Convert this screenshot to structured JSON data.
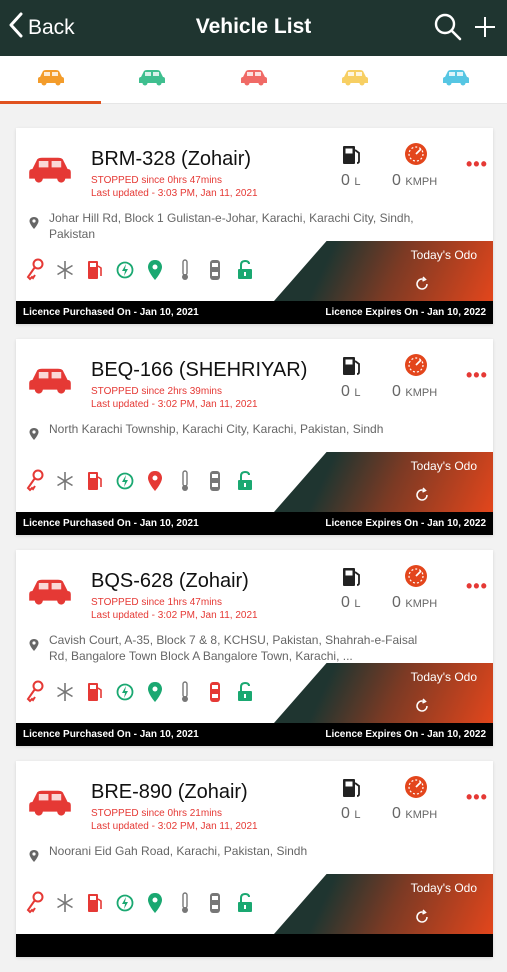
{
  "header": {
    "back_label": "Back",
    "title": "Vehicle List",
    "icons": [
      "search-icon",
      "add-icon"
    ]
  },
  "tabs": [
    {
      "color": "#f39c2b",
      "icon": "car-icon",
      "active": true
    },
    {
      "color": "#3fbf8f",
      "icon": "car-icon",
      "active": false
    },
    {
      "color": "#f06a66",
      "icon": "car-icon",
      "active": false
    },
    {
      "color": "#f7cf63",
      "icon": "car-icon",
      "active": false
    },
    {
      "color": "#56c6e3",
      "icon": "car-icon",
      "active": false
    }
  ],
  "vehicles": [
    {
      "plate": "BRM-328 (Zohair)",
      "stopped": "STOPPED since 0hrs 47mins",
      "updated": "Last updated - 3:03 PM, Jan 11, 2021",
      "fuel_value": "0",
      "fuel_unit": "L",
      "speed_value": "0",
      "speed_unit": "KMPH",
      "address": "Johar Hill Rd, Block 1 Gulistan-e-Johar, Karachi, Karachi City, Sindh, Pakistan",
      "odo_label": "Today's Odo",
      "licence_purchased": "Licence Purchased On - Jan 10, 2021",
      "licence_expires": "Licence Expires On - Jan 10, 2022",
      "location_color": "#1aa871",
      "door_color": "#777777"
    },
    {
      "plate": "BEQ-166 (SHEHRIYAR)",
      "stopped": "STOPPED since 2hrs 39mins",
      "updated": "Last updated - 3:02 PM, Jan 11, 2021",
      "fuel_value": "0",
      "fuel_unit": "L",
      "speed_value": "0",
      "speed_unit": "KMPH",
      "address": "North Karachi Township, Karachi City, Karachi, Pakistan, Sindh",
      "odo_label": "Today's Odo",
      "licence_purchased": "Licence Purchased On - Jan 10, 2021",
      "licence_expires": "Licence Expires On - Jan 10, 2022",
      "location_color": "#e53935",
      "door_color": "#777777"
    },
    {
      "plate": "BQS-628 (Zohair)",
      "stopped": "STOPPED since 1hrs 47mins",
      "updated": "Last updated - 3:02 PM, Jan 11, 2021",
      "fuel_value": "0",
      "fuel_unit": "L",
      "speed_value": "0",
      "speed_unit": "KMPH",
      "address": "Cavish Court, A-35, Block 7 & 8, KCHSU, Pakistan, Shahrah-e-Faisal Rd, Bangalore Town Block A Bangalore Town, Karachi, ...",
      "odo_label": "Today's Odo",
      "licence_purchased": "Licence Purchased On - Jan 10, 2021",
      "licence_expires": "Licence Expires On - Jan 10, 2022",
      "location_color": "#1aa871",
      "door_color": "#e53935"
    },
    {
      "plate": "BRE-890 (Zohair)",
      "stopped": "STOPPED since 0hrs 21mins",
      "updated": "Last updated - 3:02 PM, Jan 11, 2021",
      "fuel_value": "0",
      "fuel_unit": "L",
      "speed_value": "0",
      "speed_unit": "KMPH",
      "address": "Noorani Eid Gah Road, Karachi, Pakistan, Sindh",
      "odo_label": "Today's Odo",
      "licence_purchased": "",
      "licence_expires": "",
      "location_color": "#1aa871",
      "door_color": "#777777"
    }
  ],
  "status_icon_names": [
    "ignition-key-icon",
    "ac-snowflake-icon",
    "fuel-pump-icon",
    "charging-icon",
    "location-pin-icon",
    "temperature-icon",
    "door-icon",
    "lock-icon"
  ]
}
